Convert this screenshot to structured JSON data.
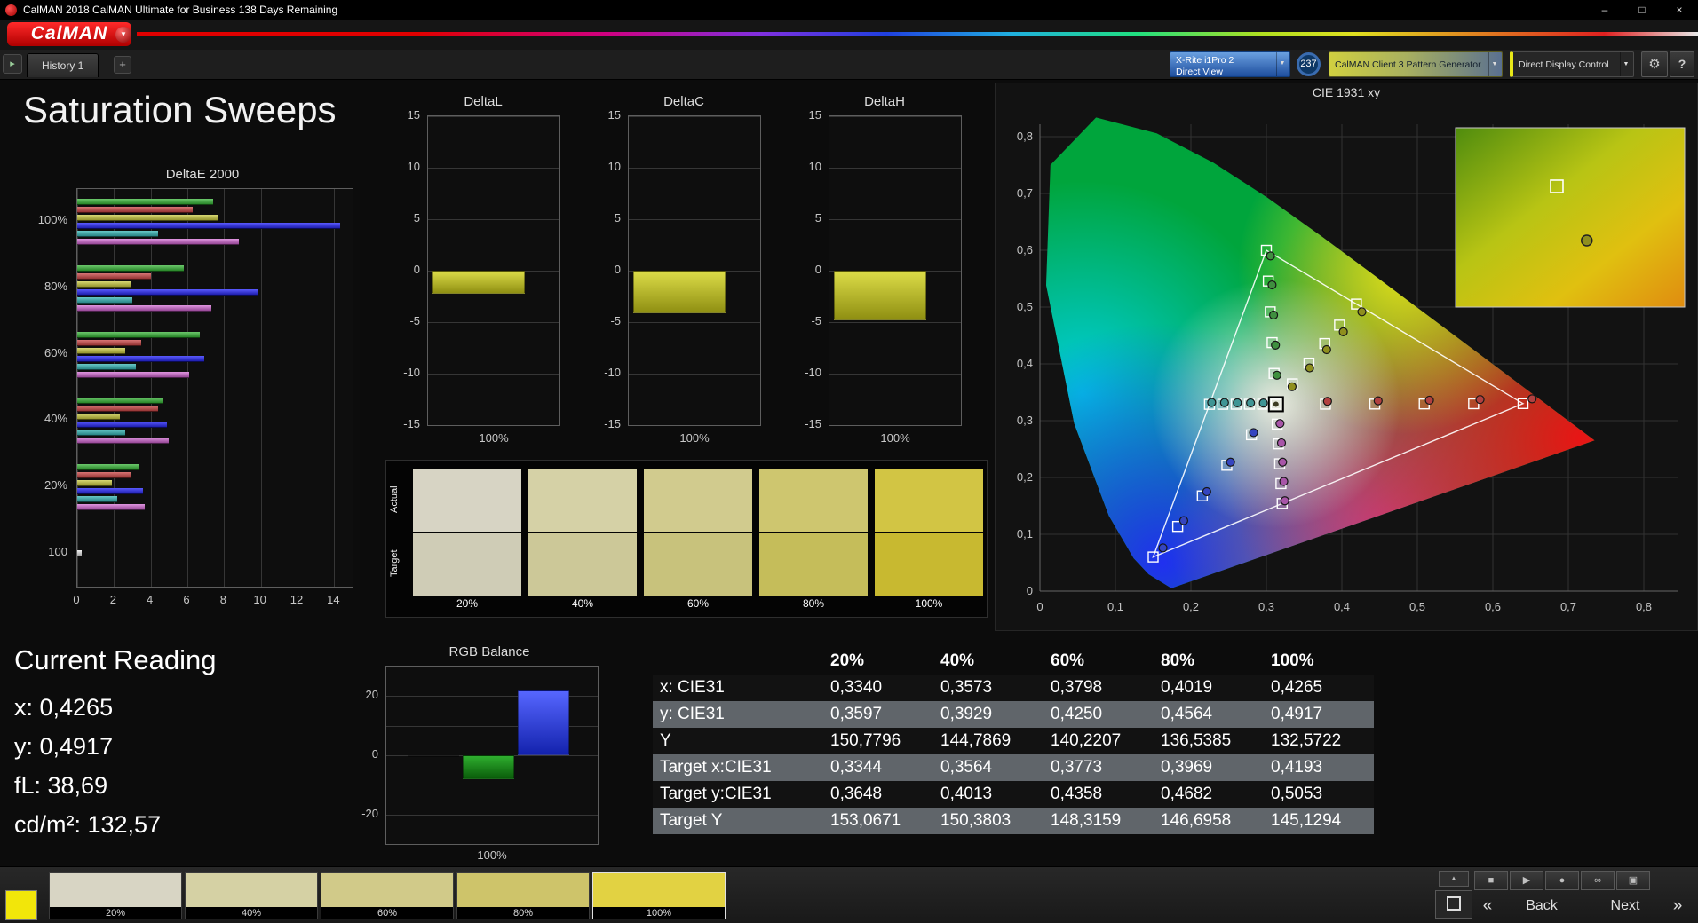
{
  "window": {
    "title": "CalMAN 2018 CalMAN Ultimate for Business 138 Days Remaining",
    "controls": {
      "minimize": "–",
      "maximize": "□",
      "close": "×"
    }
  },
  "header": {
    "logo": "CalMAN",
    "logo_arrow": "▼"
  },
  "tabs": {
    "nav": "▸",
    "history": "History 1",
    "add": "+"
  },
  "devices": {
    "meter_line1": "X-Rite i1Pro 2",
    "meter_line2": "Direct View",
    "arrow": "▼",
    "badge": "237",
    "source": "CalMAN Client 3 Pattern Generator",
    "display": "Direct Display Control",
    "gear": "⚙",
    "help": "?"
  },
  "page_title": "Saturation Sweeps",
  "delta_e": {
    "type": "bar",
    "title": "DeltaE 2000",
    "xlim": [
      0,
      15
    ],
    "x_ticks": [
      0,
      2,
      4,
      6,
      8,
      10,
      12,
      14
    ],
    "colors": {
      "green": [
        "#6cc86c",
        "#1d7a1d"
      ],
      "red": [
        "#d87474",
        "#8a2a2a"
      ],
      "yellow": [
        "#d8d874",
        "#8a8a22"
      ],
      "blue": [
        "#5a5aff",
        "#1414a0"
      ],
      "cyan": [
        "#66c8c8",
        "#1f7a7a"
      ],
      "magenta": [
        "#e096e0",
        "#8a3a8a"
      ],
      "white": [
        "#f0f0f0",
        "#9a9a9a"
      ]
    },
    "groups": [
      {
        "label": "100%",
        "bars": [
          {
            "c": "green",
            "v": 7.4
          },
          {
            "c": "red",
            "v": 6.3
          },
          {
            "c": "yellow",
            "v": 7.7
          },
          {
            "c": "blue",
            "v": 14.3
          },
          {
            "c": "cyan",
            "v": 4.4
          },
          {
            "c": "magenta",
            "v": 8.8
          }
        ]
      },
      {
        "label": "80%",
        "bars": [
          {
            "c": "green",
            "v": 5.8
          },
          {
            "c": "red",
            "v": 4.0
          },
          {
            "c": "yellow",
            "v": 2.9
          },
          {
            "c": "blue",
            "v": 9.8
          },
          {
            "c": "cyan",
            "v": 3.0
          },
          {
            "c": "magenta",
            "v": 7.3
          }
        ]
      },
      {
        "label": "60%",
        "bars": [
          {
            "c": "green",
            "v": 6.7
          },
          {
            "c": "red",
            "v": 3.5
          },
          {
            "c": "yellow",
            "v": 2.6
          },
          {
            "c": "blue",
            "v": 6.9
          },
          {
            "c": "cyan",
            "v": 3.2
          },
          {
            "c": "magenta",
            "v": 6.1
          }
        ]
      },
      {
        "label": "40%",
        "bars": [
          {
            "c": "green",
            "v": 4.7
          },
          {
            "c": "red",
            "v": 4.4
          },
          {
            "c": "yellow",
            "v": 2.3
          },
          {
            "c": "blue",
            "v": 4.9
          },
          {
            "c": "cyan",
            "v": 2.6
          },
          {
            "c": "magenta",
            "v": 5.0
          }
        ]
      },
      {
        "label": "20%",
        "bars": [
          {
            "c": "green",
            "v": 3.4
          },
          {
            "c": "red",
            "v": 2.9
          },
          {
            "c": "yellow",
            "v": 1.9
          },
          {
            "c": "blue",
            "v": 3.6
          },
          {
            "c": "cyan",
            "v": 2.2
          },
          {
            "c": "magenta",
            "v": 3.7
          }
        ]
      },
      {
        "label": "100",
        "bars": [
          {
            "c": "white",
            "v": 0.25
          }
        ]
      }
    ]
  },
  "delta_l": {
    "type": "bar",
    "title": "DeltaL",
    "value": -2.2,
    "ylim": [
      -15,
      15
    ],
    "ticks": [
      15,
      10,
      5,
      0,
      -5,
      -10,
      -15
    ],
    "x_label": "100%"
  },
  "delta_c": {
    "type": "bar",
    "title": "DeltaC",
    "value": -4.1,
    "ylim": [
      -15,
      15
    ],
    "ticks": [
      15,
      10,
      5,
      0,
      -5,
      -10,
      -15
    ],
    "x_label": "100%"
  },
  "delta_h": {
    "type": "bar",
    "title": "DeltaH",
    "value": -4.8,
    "ylim": [
      -15,
      15
    ],
    "ticks": [
      15,
      10,
      5,
      0,
      -5,
      -10,
      -15
    ],
    "x_label": "100%"
  },
  "rgb_balance": {
    "type": "bar",
    "title": "RGB Balance",
    "x_label": "100%",
    "ylim": [
      -30,
      30
    ],
    "gridlines": [
      20,
      10,
      0,
      -10,
      -20
    ],
    "ticks": [
      20,
      0,
      -20
    ],
    "bars": [
      {
        "name": "red",
        "v": -0.6,
        "colors": [
          "#ff4040",
          "#990000"
        ]
      },
      {
        "name": "green",
        "v": -8,
        "colors": [
          "#2fae2f",
          "#0a5c0a"
        ]
      },
      {
        "name": "blue",
        "v": 22,
        "colors": [
          "#5666ff",
          "#1322ad"
        ]
      }
    ]
  },
  "swatch_compare": {
    "row_labels": [
      "Actual",
      "Target"
    ],
    "columns": [
      {
        "label": "20%",
        "actual": "#d7d4c4",
        "target": "#cfccb6"
      },
      {
        "label": "40%",
        "actual": "#d5d1a6",
        "target": "#ccc898"
      },
      {
        "label": "60%",
        "actual": "#d1cb8e",
        "target": "#c8c27c"
      },
      {
        "label": "80%",
        "actual": "#cec66f",
        "target": "#c5bd5a"
      },
      {
        "label": "100%",
        "actual": "#d2c544",
        "target": "#c8b930"
      }
    ]
  },
  "cie": {
    "title": "CIE 1931 xy",
    "x_ticks": [
      "0",
      "0,1",
      "0,2",
      "0,3",
      "0,4",
      "0,5",
      "0,6",
      "0,7",
      "0,8"
    ],
    "y_ticks": [
      "0",
      "0,1",
      "0,2",
      "0,3",
      "0,4",
      "0,5",
      "0,6",
      "0,7",
      "0,8"
    ],
    "white_point": [
      0.3127,
      0.329
    ],
    "triangle": [
      [
        0.64,
        0.33
      ],
      [
        0.3,
        0.6
      ],
      [
        0.15,
        0.06
      ]
    ],
    "sweeps": [
      {
        "name": "yellow",
        "dot": "#8f8f1e",
        "targets": [
          [
            0.3344,
            0.3648
          ],
          [
            0.3564,
            0.4013
          ],
          [
            0.3773,
            0.4358
          ],
          [
            0.3969,
            0.4682
          ],
          [
            0.4193,
            0.5053
          ]
        ],
        "measured": [
          [
            0.334,
            0.3597
          ],
          [
            0.3573,
            0.3929
          ],
          [
            0.3798,
            0.425
          ],
          [
            0.4019,
            0.4564
          ],
          [
            0.4265,
            0.4917
          ]
        ]
      },
      {
        "name": "red",
        "dot": "#b24040",
        "targets": [
          [
            0.3782,
            0.329
          ],
          [
            0.4436,
            0.3292
          ],
          [
            0.5091,
            0.3294
          ],
          [
            0.5745,
            0.3297
          ],
          [
            0.64,
            0.33
          ]
        ],
        "measured": [
          [
            0.381,
            0.334
          ],
          [
            0.448,
            0.335
          ],
          [
            0.516,
            0.336
          ],
          [
            0.583,
            0.3372
          ],
          [
            0.652,
            0.3385
          ]
        ]
      },
      {
        "name": "green",
        "dot": "#3f8f3f",
        "targets": [
          [
            0.3102,
            0.3832
          ],
          [
            0.3076,
            0.4374
          ],
          [
            0.3051,
            0.4916
          ],
          [
            0.3025,
            0.5458
          ],
          [
            0.3,
            0.6
          ]
        ],
        "measured": [
          [
            0.314,
            0.38
          ],
          [
            0.312,
            0.433
          ],
          [
            0.3095,
            0.486
          ],
          [
            0.3075,
            0.539
          ],
          [
            0.3055,
            0.59
          ]
        ]
      },
      {
        "name": "blue",
        "dot": "#3545c0",
        "targets": [
          [
            0.2802,
            0.2752
          ],
          [
            0.2476,
            0.2214
          ],
          [
            0.2151,
            0.1676
          ],
          [
            0.1825,
            0.1138
          ],
          [
            0.15,
            0.06
          ]
        ],
        "measured": [
          [
            0.283,
            0.279
          ],
          [
            0.2525,
            0.227
          ],
          [
            0.221,
            0.175
          ],
          [
            0.1905,
            0.124
          ],
          [
            0.163,
            0.076
          ]
        ]
      },
      {
        "name": "cyan",
        "dot": "#3f9595",
        "targets": [
          [
            0.2951,
            0.329
          ],
          [
            0.2775,
            0.3289
          ],
          [
            0.2599,
            0.3289
          ],
          [
            0.2422,
            0.3288
          ],
          [
            0.2246,
            0.3287
          ]
        ],
        "measured": [
          [
            0.296,
            0.331
          ],
          [
            0.279,
            0.3312
          ],
          [
            0.2615,
            0.3315
          ],
          [
            0.2445,
            0.3318
          ],
          [
            0.2275,
            0.332
          ]
        ]
      },
      {
        "name": "magenta",
        "dot": "#a855a8",
        "targets": [
          [
            0.3143,
            0.294
          ],
          [
            0.316,
            0.2591
          ],
          [
            0.3176,
            0.2241
          ],
          [
            0.3193,
            0.1892
          ],
          [
            0.3209,
            0.1542
          ]
        ],
        "measured": [
          [
            0.318,
            0.295
          ],
          [
            0.32,
            0.261
          ],
          [
            0.3215,
            0.227
          ],
          [
            0.323,
            0.193
          ],
          [
            0.3245,
            0.159
          ]
        ]
      }
    ],
    "inset": {
      "target": [
        0.4193,
        0.5053
      ],
      "measured": [
        0.4265,
        0.4917
      ]
    }
  },
  "current_reading": {
    "title": "Current Reading",
    "lines": [
      "x: 0,4265",
      "y: 0,4917",
      "fL: 38,69",
      "cd/m²: 132,57"
    ]
  },
  "table": {
    "headers": [
      "",
      "20%",
      "40%",
      "60%",
      "80%",
      "100%"
    ],
    "rows": [
      [
        "x: CIE31",
        "0,3340",
        "0,3573",
        "0,3798",
        "0,4019",
        "0,4265"
      ],
      [
        "y: CIE31",
        "0,3597",
        "0,3929",
        "0,4250",
        "0,4564",
        "0,4917"
      ],
      [
        "Y",
        "150,7796",
        "144,7869",
        "140,2207",
        "136,5385",
        "132,5722"
      ],
      [
        "Target x:CIE31",
        "0,3344",
        "0,3564",
        "0,3773",
        "0,3969",
        "0,4193"
      ],
      [
        "Target y:CIE31",
        "0,3648",
        "0,4013",
        "0,4358",
        "0,4682",
        "0,5053"
      ],
      [
        "Target Y",
        "153,0671",
        "150,3803",
        "148,3159",
        "146,6958",
        "145,1294"
      ]
    ]
  },
  "bottom": {
    "patch_color": "#f2e60a",
    "selected": "100%",
    "swatches": [
      {
        "label": "20%",
        "color": "#d8d5c4"
      },
      {
        "label": "40%",
        "color": "#d5d1a4"
      },
      {
        "label": "60%",
        "color": "#d1ca89"
      },
      {
        "label": "80%",
        "color": "#cec46a"
      },
      {
        "label": "100%",
        "color": "#e2d242"
      }
    ],
    "eject": "▲",
    "transport": [
      {
        "name": "stop",
        "glyph": "■"
      },
      {
        "name": "play",
        "glyph": "▶"
      },
      {
        "name": "record",
        "glyph": "●"
      },
      {
        "name": "loop",
        "glyph": "∞"
      },
      {
        "name": "display",
        "glyph": "▣"
      }
    ],
    "nav": {
      "prev": "«",
      "back": "Back",
      "next": "Next",
      "fwd": "»"
    }
  }
}
